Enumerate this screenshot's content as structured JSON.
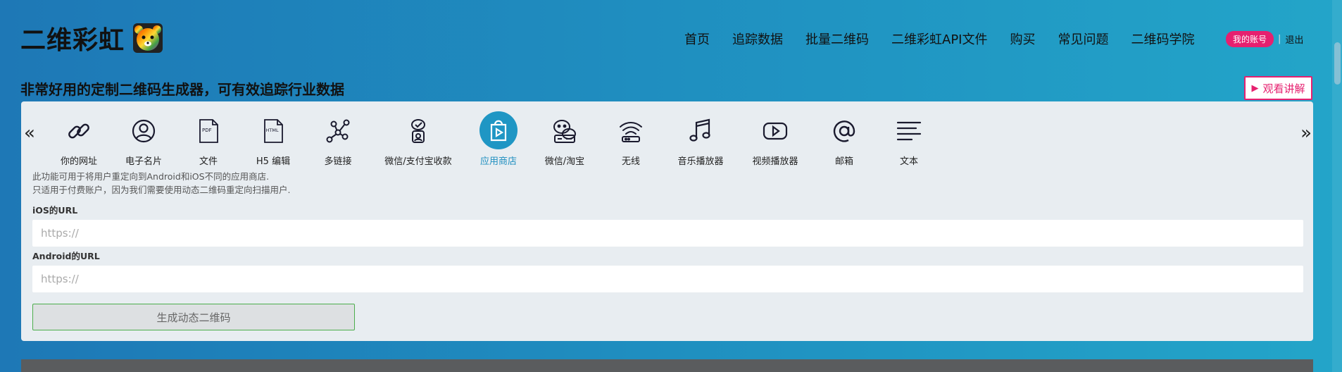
{
  "header": {
    "logo_text": "二维彩虹",
    "nav": [
      "首页",
      "追踪数据",
      "批量二维码",
      "二维彩虹API文件",
      "购买",
      "常见问题",
      "二维码学院"
    ],
    "account_label": "我的账号",
    "separator": "|",
    "logout_label": "退出"
  },
  "tagline": "非常好用的定制二维码生成器，可有效追踪行业数据",
  "watch_button": {
    "icon": "play-icon",
    "label": "观看讲解"
  },
  "carousel": {
    "prev_arrow": "«",
    "next_arrow": "»",
    "types": [
      {
        "label": "你的网址",
        "icon": "link-icon"
      },
      {
        "label": "电子名片",
        "icon": "user-circle-icon"
      },
      {
        "label": "文件",
        "icon": "pdf-file-icon"
      },
      {
        "label": "H5 编辑",
        "icon": "html-file-icon"
      },
      {
        "label": "多链接",
        "icon": "multi-link-icon"
      },
      {
        "label": "微信/支付宝收款",
        "icon": "payment-icon"
      },
      {
        "label": "应用商店",
        "icon": "app-store-icon",
        "active": true
      },
      {
        "label": "微信/淘宝",
        "icon": "wechat-icon"
      },
      {
        "label": "无线",
        "icon": "wifi-icon"
      },
      {
        "label": "音乐播放器",
        "icon": "music-icon"
      },
      {
        "label": "视频播放器",
        "icon": "video-icon"
      },
      {
        "label": "邮箱",
        "icon": "at-icon"
      },
      {
        "label": "文本",
        "icon": "text-lines-icon"
      }
    ]
  },
  "form": {
    "desc_line1": "此功能可用于将用户重定向到Android和iOS不同的应用商店.",
    "desc_line2": "只适用于付费账户，因为我们需要使用动态二维码重定向扫描用户.",
    "ios_label": "iOS的URL",
    "ios_placeholder": "https://",
    "android_label": "Android的URL",
    "android_placeholder": "https://",
    "generate_label": "生成动态二维码"
  },
  "colors": {
    "accent": "#1f96c4",
    "pink": "#e6206f",
    "panel_bg": "#e8edf1",
    "button_border": "#4cae4c"
  }
}
